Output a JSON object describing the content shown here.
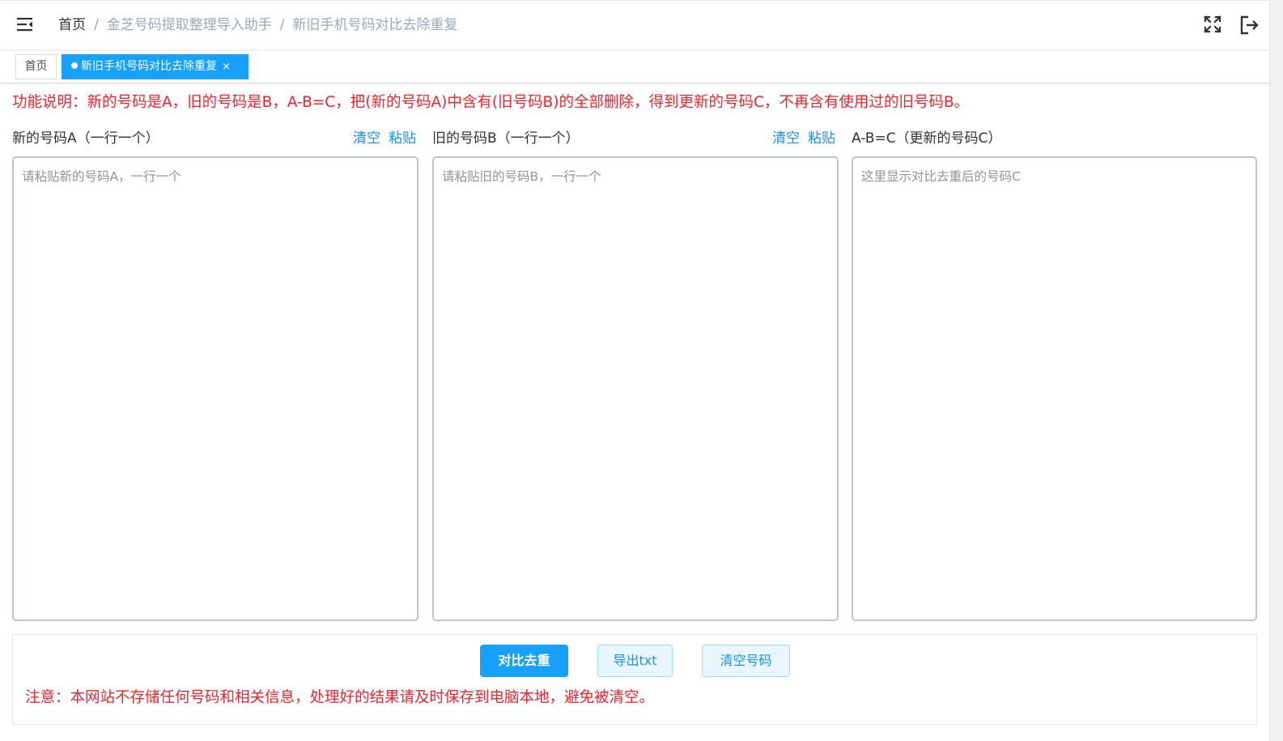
{
  "header": {
    "breadcrumb": [
      "首页",
      "金芝号码提取整理导入助手",
      "新旧手机号码对比去除重复"
    ],
    "separator": "/",
    "icons": [
      "menu-fold-icon",
      "fullscreen-icon",
      "logout-icon"
    ]
  },
  "tags": {
    "home": "首页",
    "active": "新旧手机号码对比去除重复",
    "close": "×"
  },
  "description": "功能说明：新的号码是A，旧的号码是B，A-B=C，把(新的号码A)中含有(旧号码B)的全部删除，得到更新的号码C，不再含有使用过的旧号码B。",
  "panels": {
    "a": {
      "title": "新的号码A（一行一个）",
      "clear": "清空",
      "paste": "粘贴",
      "placeholder": "请粘贴新的号码A，一行一个",
      "value": ""
    },
    "b": {
      "title": "旧的号码B（一行一个）",
      "clear": "清空",
      "paste": "粘贴",
      "placeholder": "请粘贴旧的号码B，一行一个",
      "value": ""
    },
    "c": {
      "title": "A-B=C（更新的号码C）",
      "placeholder": "这里显示对比去重后的号码C",
      "value": ""
    }
  },
  "buttons": {
    "compare": "对比去重",
    "export": "导出txt",
    "clear": "清空号码"
  },
  "notice": "注意：本网站不存储任何号码和相关信息，处理好的结果请及时保存到电脑本地，避免被清空。",
  "colors": {
    "primary": "#16a0ff",
    "link": "#1890ff",
    "warning_text": "#f5222d",
    "breadcrumb_muted": "#97a8be"
  }
}
